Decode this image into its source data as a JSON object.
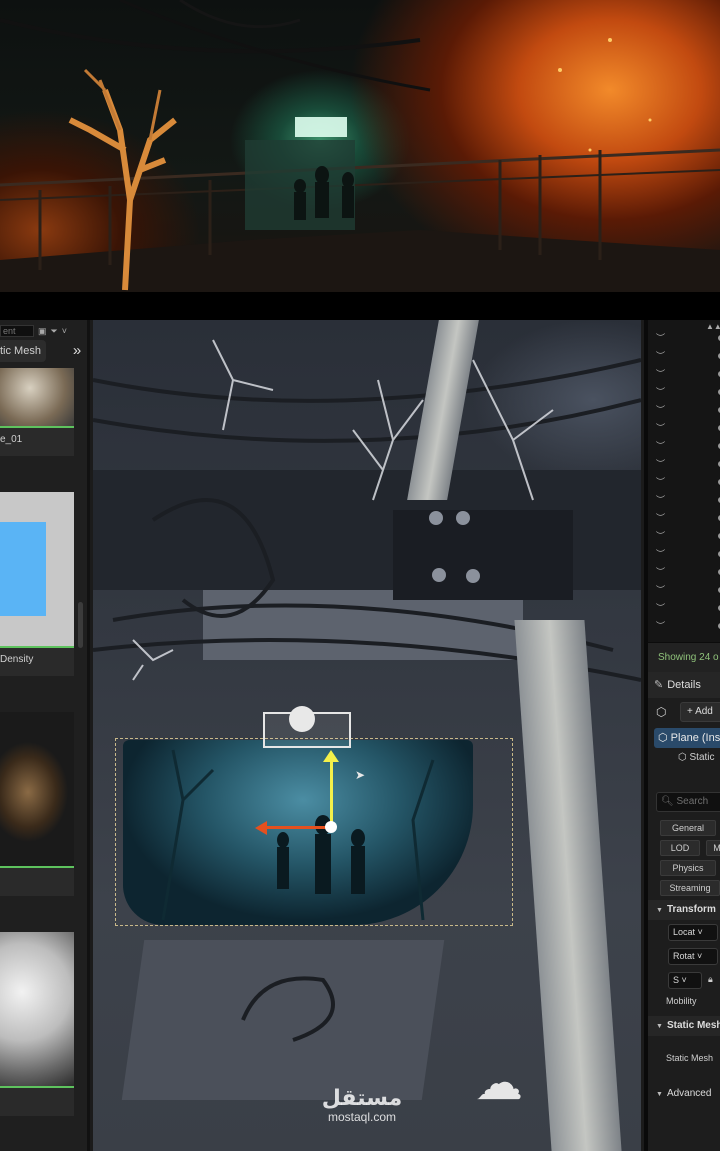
{
  "content_browser": {
    "search_placeholder": "ent",
    "filter_label": "tic Mesh",
    "assets": [
      {
        "label": "e_01"
      },
      {
        "label": ""
      },
      {
        "label": "Density"
      },
      {
        "label": ""
      },
      {
        "label": ""
      }
    ]
  },
  "outliner": {
    "footer_text": "Showing 24 o"
  },
  "details": {
    "tab_label": "Details",
    "add_label": "Add",
    "component_name": "Plane (Ins",
    "subcomponent_name": "Static",
    "search_placeholder": "Search",
    "filter_chips": [
      "General",
      "LOD",
      "M",
      "Physics",
      "Streaming"
    ],
    "sections": {
      "transform": "Transform",
      "static_mesh": "Static Mesh",
      "advanced": "Advanced"
    },
    "transform": {
      "location_label": "Locat",
      "rotation_label": "Rotat",
      "scale_label": "S",
      "mobility_label": "Mobility"
    },
    "static_mesh_label": "Static Mesh"
  },
  "watermark": {
    "arabic": "مستقل",
    "latin": "mostaql.com"
  },
  "colors": {
    "gizmo_y": "#f4f04a",
    "gizmo_x": "#e5501e",
    "asset_bar": "#5ec35e",
    "selected_component": "#2a4a6a",
    "outliner_footer_text": "#8fc27a"
  }
}
